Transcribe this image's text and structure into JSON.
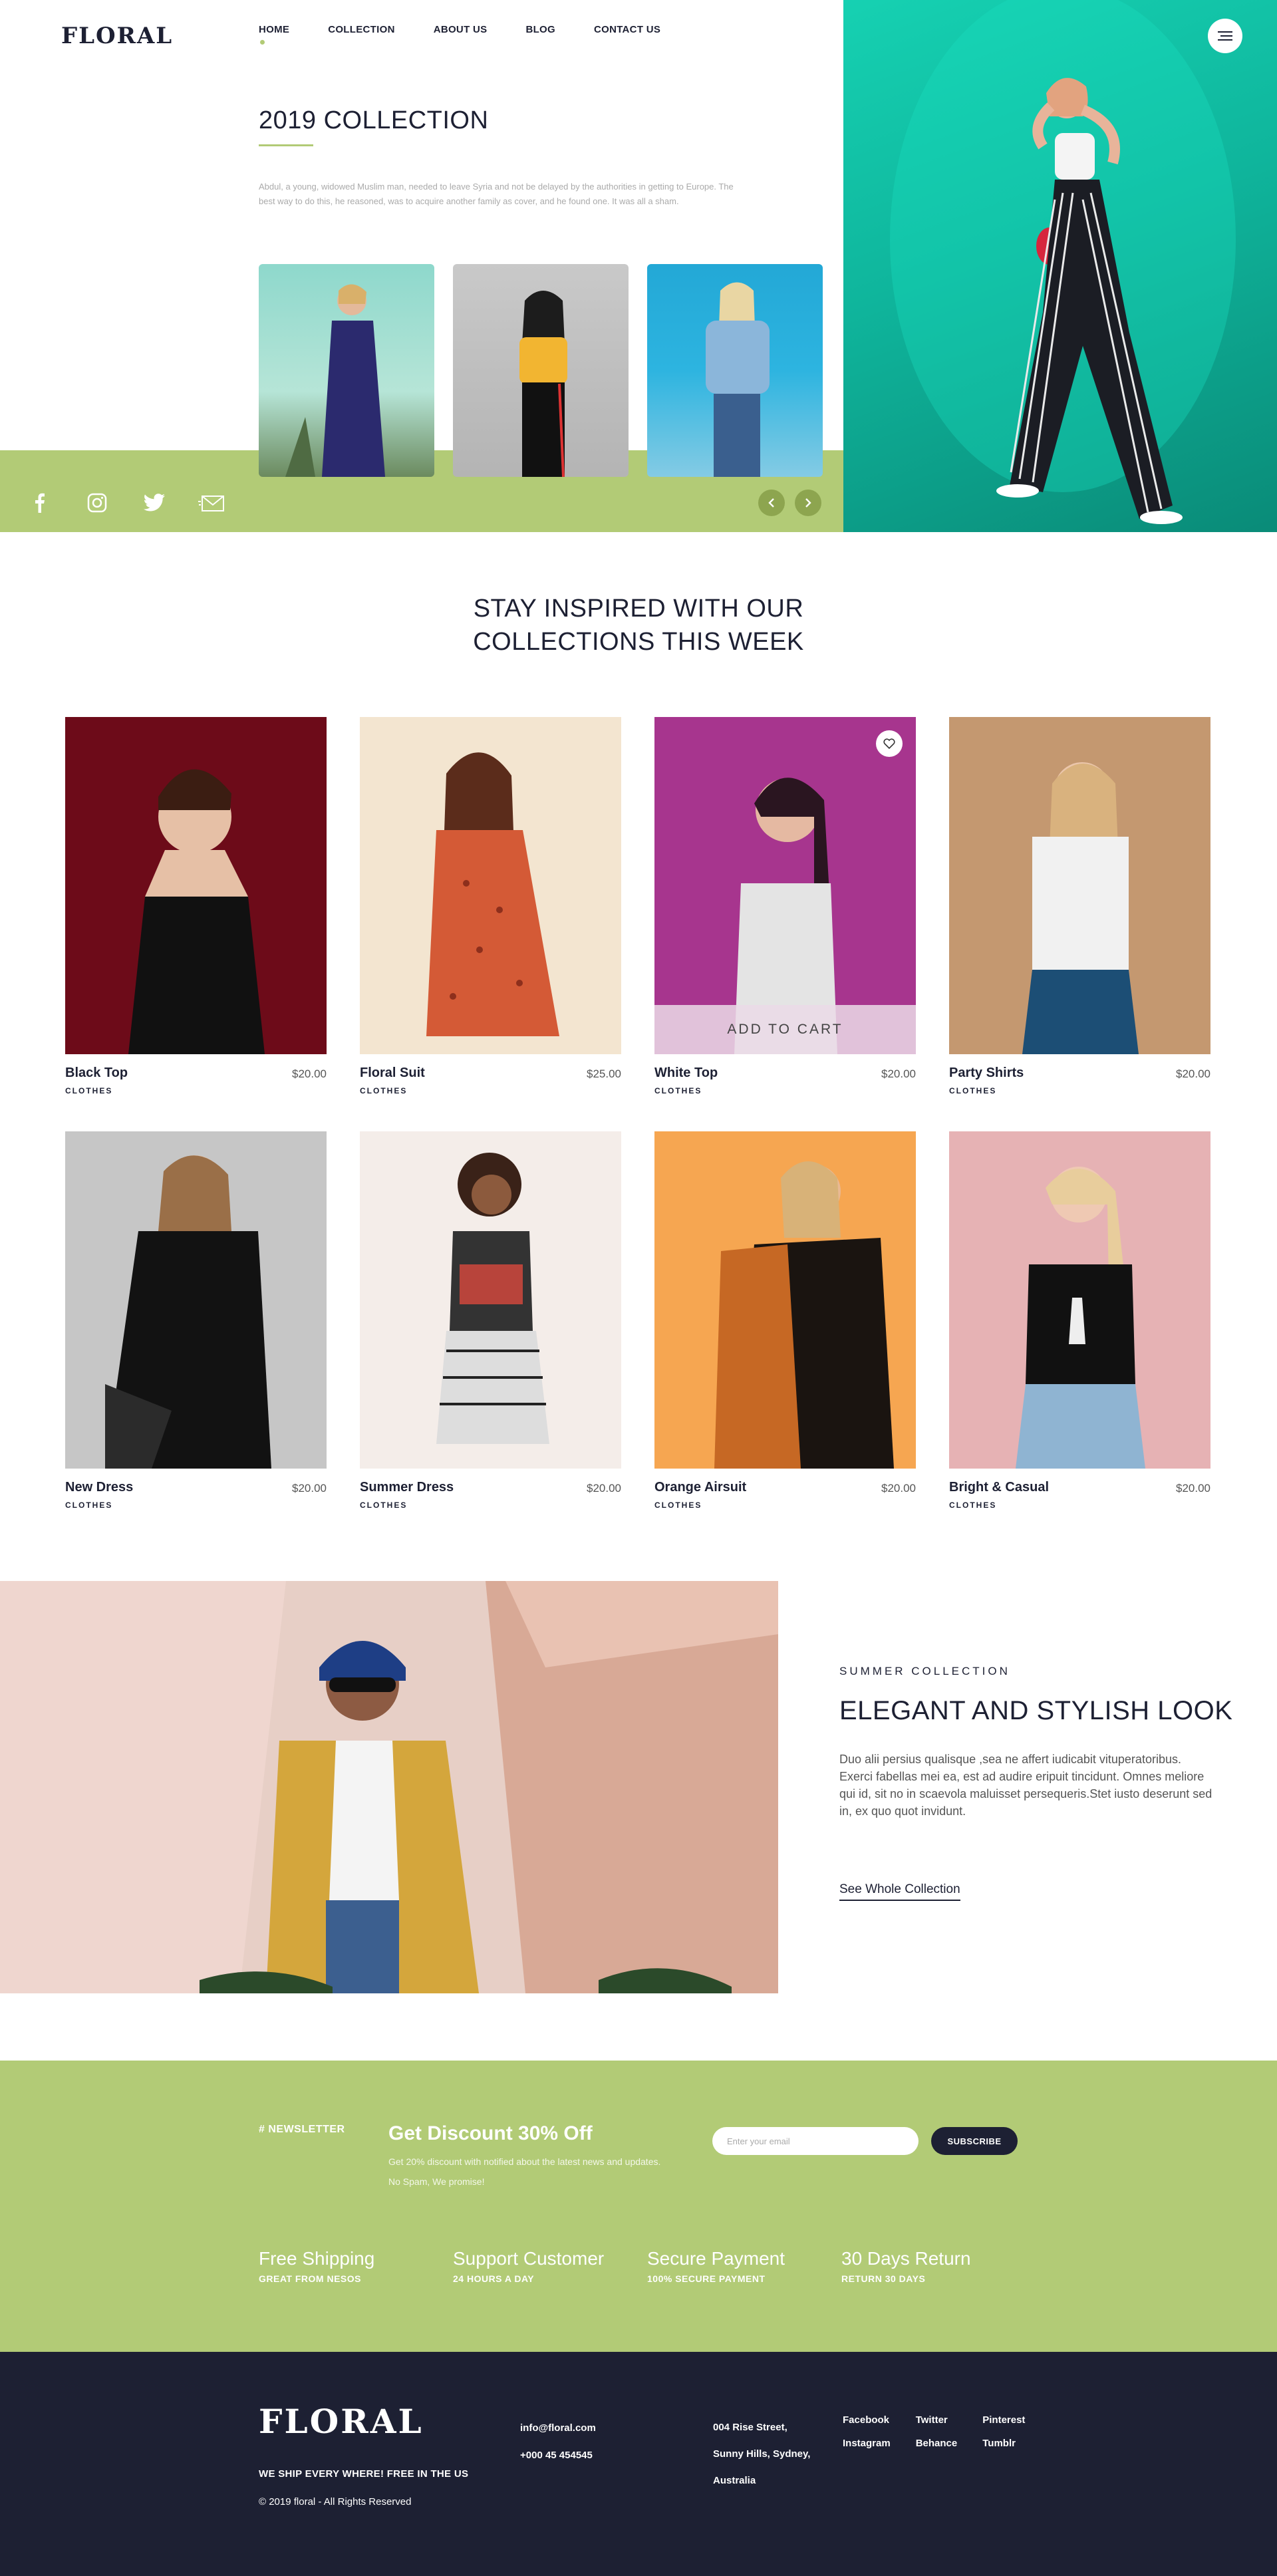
{
  "brand": {
    "logo": "FLORAL"
  },
  "nav": {
    "items": [
      "HOME",
      "COLLECTION",
      "ABOUT US",
      "BLOG",
      "CONTACT US"
    ],
    "active": "HOME"
  },
  "hero": {
    "title": "2019 COLLECTION",
    "description": "Abdul, a young, widowed Muslim man, needed to leave Syria and not be delayed by the authorities in getting to Europe. The best way to do this, he reasoned, was to acquire another family as cover, and he found one. It was all a sham.",
    "social_icons": [
      "facebook-icon",
      "instagram-icon",
      "twitter-icon",
      "mail-icon"
    ],
    "arrows": [
      "prev-arrow-icon",
      "next-arrow-icon"
    ]
  },
  "collections": {
    "title_line1": "STAY INSPIRED WITH OUR",
    "title_line2": "COLLECTIONS THIS WEEK",
    "add_to_cart": "ADD TO CART",
    "products": [
      {
        "name": "Black Top",
        "price": "$20.00",
        "category": "CLOTHES"
      },
      {
        "name": "Floral Suit",
        "price": "$25.00",
        "category": "CLOTHES"
      },
      {
        "name": "White Top",
        "price": "$20.00",
        "category": "CLOTHES"
      },
      {
        "name": "Party Shirts",
        "price": "$20.00",
        "category": "CLOTHES"
      },
      {
        "name": "New Dress",
        "price": "$20.00",
        "category": "CLOTHES"
      },
      {
        "name": "Summer Dress",
        "price": "$20.00",
        "category": "CLOTHES"
      },
      {
        "name": "Orange Airsuit",
        "price": "$20.00",
        "category": "CLOTHES"
      },
      {
        "name": "Bright & Casual",
        "price": "$20.00",
        "category": "CLOTHES"
      }
    ]
  },
  "promo": {
    "subtitle": "SUMMER COLLECTION",
    "title": "ELEGANT AND STYLISH LOOK",
    "text": "Duo alii persius qualisque ,sea ne affert iudicabit vituperatoribus. Exerci fabellas mei ea, est ad audire eripuit tincidunt. Omnes meliore qui id, sit no in scaevola maluisset persequeris.Stet iusto deserunt sed in, ex quo quot invidunt.",
    "link": "See Whole Collection"
  },
  "newsletter": {
    "tag": "# NEWSLETTER",
    "title": "Get Discount 30% Off",
    "desc_line1": "Get 20% discount with notified about the latest news and updates.",
    "desc_line2": "No Spam, We promise!",
    "placeholder": "Enter your email",
    "button": "SUBSCRIBE"
  },
  "features": [
    {
      "title": "Free Shipping",
      "sub": "GREAT FROM NESOS"
    },
    {
      "title": "Support Customer",
      "sub": "24 HOURS A DAY"
    },
    {
      "title": "Secure Payment",
      "sub": "100% SECURE PAYMENT"
    },
    {
      "title": "30 Days Return",
      "sub": "RETURN 30 DAYS"
    }
  ],
  "footer": {
    "logo": "FLORAL",
    "tagline": "WE SHIP EVERY WHERE! FREE IN THE US",
    "copyright": "© 2019 floral - All Rights Reserved",
    "email": "info@floral.com",
    "phone": "+000 45 454545",
    "address_line1": "004 Rise Street,",
    "address_line2": "Sunny Hills, Sydney,",
    "address_line3": "Australia",
    "social": [
      "Facebook",
      "Twitter",
      "Pinterest",
      "Instagram",
      "Behance",
      "Tumblr"
    ]
  },
  "colors": {
    "accent": "#b2cb76",
    "dark": "#1d2033",
    "teal": "#12c6a8"
  }
}
